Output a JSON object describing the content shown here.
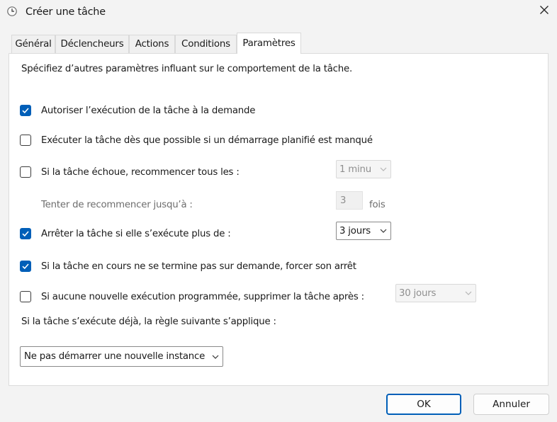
{
  "window": {
    "title": "Créer une tâche",
    "icon": "clock-icon",
    "close_icon": "close-icon"
  },
  "tabs": [
    {
      "label": "Général"
    },
    {
      "label": "Déclencheurs"
    },
    {
      "label": "Actions"
    },
    {
      "label": "Conditions"
    },
    {
      "label": "Paramètres",
      "selected": true
    }
  ],
  "panel": {
    "intro": "Spécifiez d’autres paramètres influant sur le comportement de la tâche.",
    "allow_on_demand": {
      "label": "Autoriser l’exécution de la tâche à la demande",
      "checked": true
    },
    "run_if_missed": {
      "label": "Exécuter la tâche dès que possible si un démarrage planifié est manqué",
      "checked": false
    },
    "restart_on_fail": {
      "label": "Si la tâche échoue, recommencer tous les :",
      "checked": false,
      "interval": "1 minu"
    },
    "restart_attempts": {
      "label": "Tenter de recommencer jusqu’à :",
      "value": "3",
      "unit": "fois"
    },
    "stop_if_longer": {
      "label": "Arrêter la tâche si elle s’exécute plus de :",
      "checked": true,
      "duration": "3 jours"
    },
    "force_stop": {
      "label": "Si la tâche en cours ne se termine pas sur demande, forcer son arrêt",
      "checked": true
    },
    "delete_if_none": {
      "label": "Si aucune nouvelle exécution programmée, supprimer la tâche après :",
      "checked": false,
      "after": "30 jours"
    },
    "rule_label": "Si la tâche s’exécute déjà, la règle suivante s’applique :",
    "rule_value": "Ne pas démarrer une nouvelle instance"
  },
  "buttons": {
    "ok": "OK",
    "cancel": "Annuler"
  },
  "colors": {
    "accent": "#005fb8",
    "window_bg": "#f3f3f3",
    "panel_bg": "#ffffff"
  }
}
